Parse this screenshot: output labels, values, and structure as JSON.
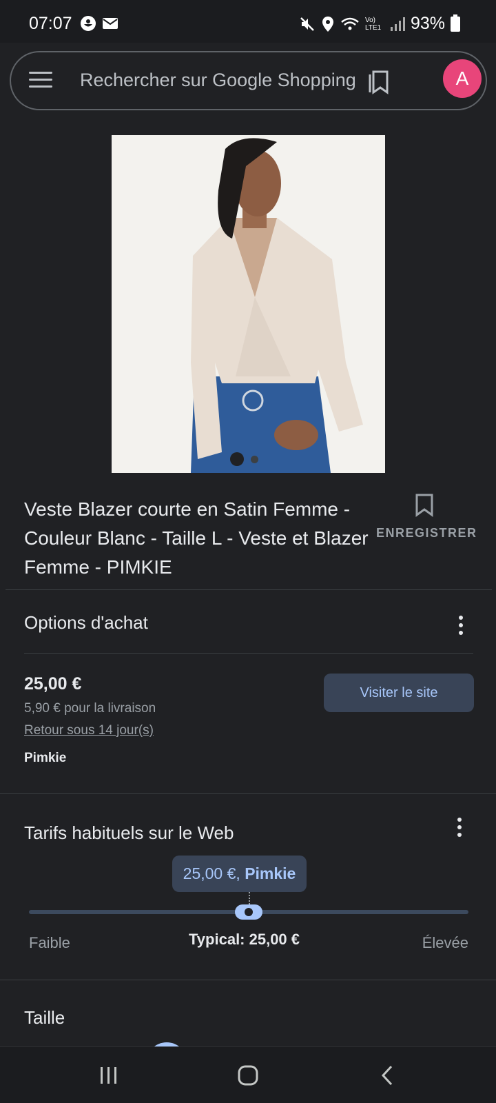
{
  "status_bar": {
    "time": "07:07",
    "battery": "93%",
    "lte_label": "Vo) LTE1"
  },
  "search": {
    "placeholder": "Rechercher sur Google Shopping",
    "avatar_letter": "A",
    "avatar_color": "#e8457a"
  },
  "product": {
    "title": "Veste Blazer courte en Satin Femme - Couleur Blanc - Taille L - Veste et Blazer Femme - PIMKIE",
    "save_label": "ENREGISTRER",
    "image_dots": 2,
    "active_dot": 1
  },
  "purchase_options": {
    "title": "Options d'achat",
    "price": "25,00 €",
    "delivery": "5,90 € pour la livraison",
    "returns": "Retour sous 14 jour(s)",
    "merchant": "Pimkie",
    "visit_label": "Visiter le site"
  },
  "price_range": {
    "title": "Tarifs habituels sur le Web",
    "tooltip_price": "25,00 €,",
    "tooltip_merchant": "Pimkie",
    "low_label": "Faible",
    "typical_label": "Typical: 25,00 €",
    "high_label": "Élevée",
    "position_fraction": 0.5
  },
  "size_section": {
    "title": "Taille"
  },
  "nav": {
    "icons": [
      "recents-icon",
      "home-icon",
      "back-icon"
    ]
  },
  "colors": {
    "background": "#202124",
    "accent": "#a8c7fa",
    "button_bg": "#394457"
  }
}
